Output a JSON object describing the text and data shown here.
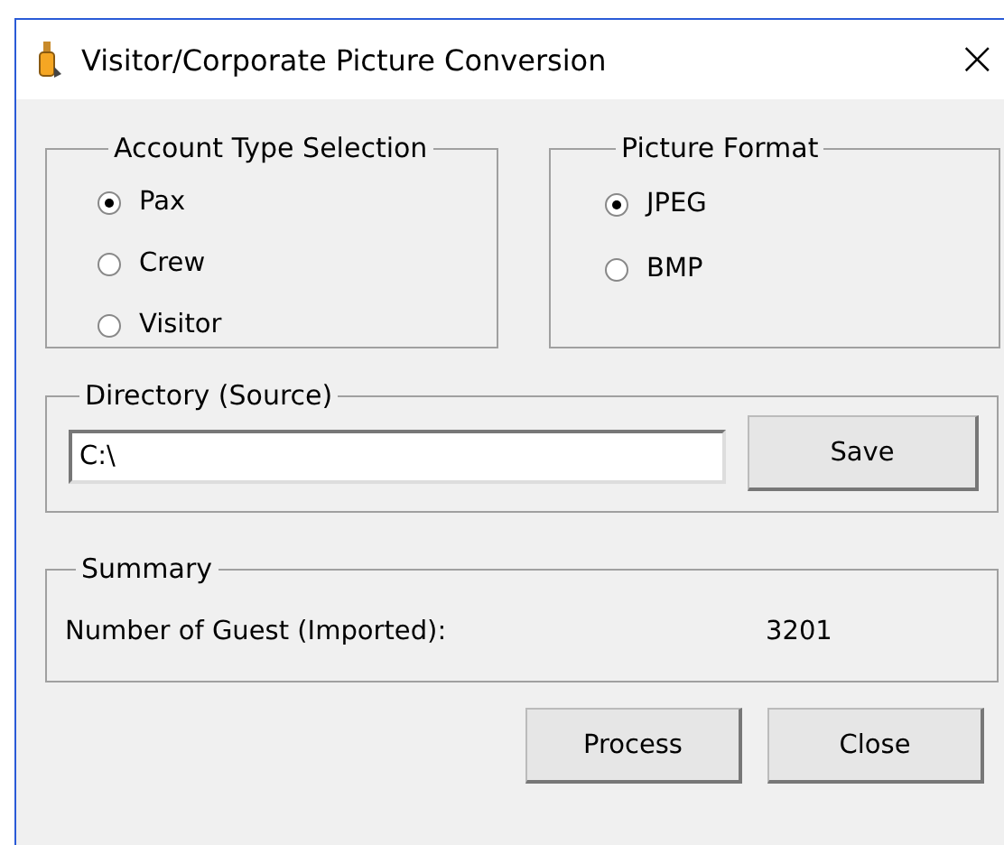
{
  "window": {
    "title": "Visitor/Corporate Picture Conversion",
    "close": "×"
  },
  "account_type": {
    "title": "Account Type Selection",
    "options": [
      {
        "label": "Pax",
        "selected": true
      },
      {
        "label": "Crew",
        "selected": false
      },
      {
        "label": "Visitor",
        "selected": false
      }
    ]
  },
  "picture_format": {
    "title": "Picture Format",
    "options": [
      {
        "label": "JPEG",
        "selected": true
      },
      {
        "label": "BMP",
        "selected": false
      }
    ]
  },
  "directory": {
    "title": "Directory (Source)",
    "value": "C:\\",
    "button": "Save"
  },
  "summary": {
    "title": "Summary",
    "label": "Number of Guest (Imported):",
    "value": "3201"
  },
  "buttons": [
    "Process",
    "Close"
  ]
}
